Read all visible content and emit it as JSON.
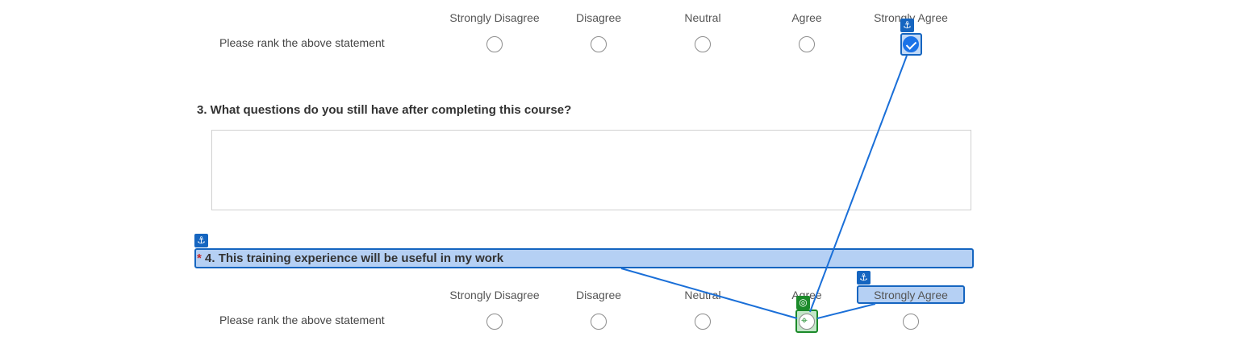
{
  "scale_labels": [
    "Strongly Disagree",
    "Disagree",
    "Neutral",
    "Agree",
    "Strongly Agree"
  ],
  "q2": {
    "row_label": "Please rank the above statement",
    "selected": "Strongly Agree"
  },
  "q3": {
    "title": "3. What questions do you still have after completing this course?",
    "answer": ""
  },
  "q4": {
    "required_mark": "*",
    "title": "4. This training experience will be useful in my work",
    "row_label": "Please rank the above statement",
    "selected": ""
  },
  "annotations": {
    "anchor_icon": "anchor-icon",
    "target_icon": "crosshair-icon",
    "anchor_color": "#1565c0",
    "target_color": "#1b8a2a"
  }
}
